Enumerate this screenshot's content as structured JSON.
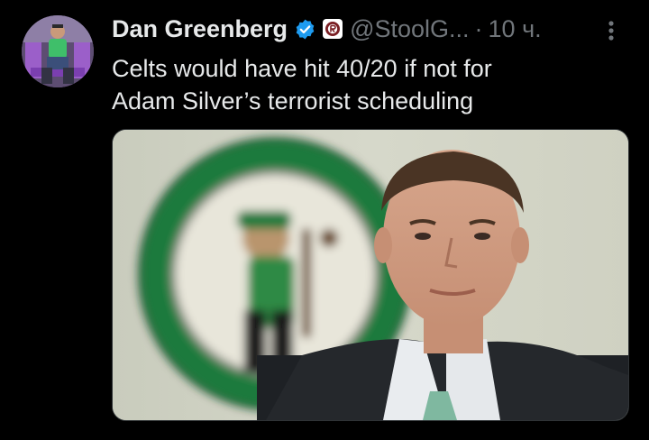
{
  "tweet": {
    "display_name": "Dan Greenberg",
    "handle": "@StoolG...",
    "separator": "·",
    "timestamp": "10 ч.",
    "text_lines": [
      "Celts would have hit 40/20 if not for",
      "Adam Silver’s terrorist scheduling"
    ],
    "icons": {
      "verified": "verified-badge-icon",
      "affiliate": "affiliate-badge-icon",
      "more": "more-options-icon"
    }
  },
  "colors": {
    "background": "#000000",
    "primary_text": "#e7e9ea",
    "secondary_text": "#71767b",
    "verified_blue": "#1d9bf0",
    "celtics_green": "#1f7a3e"
  }
}
